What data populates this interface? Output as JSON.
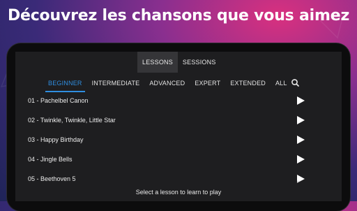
{
  "promo": {
    "headline": "Découvrez les chansons que vous aimez"
  },
  "top_tabs": [
    {
      "label": "LESSONS",
      "active": true
    },
    {
      "label": "SESSIONS",
      "active": false
    }
  ],
  "levels": [
    {
      "label": "BEGINNER",
      "active": true
    },
    {
      "label": "INTERMEDIATE",
      "active": false
    },
    {
      "label": "ADVANCED",
      "active": false
    },
    {
      "label": "EXPERT",
      "active": false
    },
    {
      "label": "EXTENDED",
      "active": false
    },
    {
      "label": "ALL",
      "active": false
    }
  ],
  "search": {
    "icon": "search-icon"
  },
  "lessons": [
    {
      "title": "01 - Pachelbel Canon",
      "icon": "play-icon"
    },
    {
      "title": "02 - Twinkle, Twinkle, Little Star",
      "icon": "play-icon"
    },
    {
      "title": "03 - Happy Birthday",
      "icon": "play-icon"
    },
    {
      "title": "04 - Jingle Bells",
      "icon": "play-icon"
    },
    {
      "title": "05 - Beethoven 5",
      "icon": "play-icon"
    }
  ],
  "footer": {
    "hint": "Select a lesson to learn to play"
  },
  "colors": {
    "accent": "#2f8ee0",
    "screen_bg": "#1e1e20",
    "active_tab_bg": "#353538",
    "background_pink": "#d9307f",
    "background_purple": "#3a2a78"
  }
}
